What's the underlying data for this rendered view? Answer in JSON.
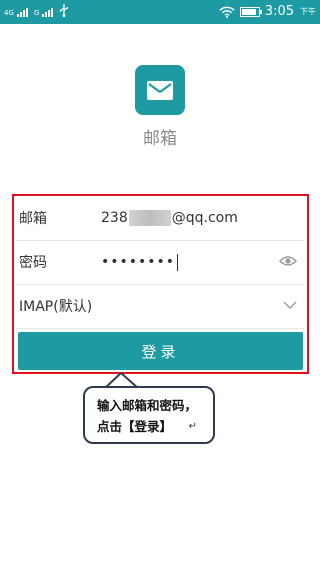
{
  "status_bar": {
    "network_1": "4G",
    "network_2": "G",
    "usb_icon": "usb-icon",
    "wifi_icon": "wifi-icon",
    "battery_level": 0.85,
    "time": "3:05",
    "ampm": "下午"
  },
  "app": {
    "icon": "mail-icon",
    "name": "邮箱"
  },
  "form": {
    "email_label": "邮箱",
    "email_prefix": "238",
    "email_suffix": "@qq.com",
    "password_label": "密码",
    "password_value": "••••••••",
    "protocol_value": "IMAP(默认)",
    "login_label": "登录"
  },
  "callout": {
    "line1": "输入邮箱和密码，",
    "line2": "点击【登录】",
    "return_mark": "↵"
  },
  "colors": {
    "accent": "#1e9aa3",
    "highlight_border": "#e0101e"
  }
}
